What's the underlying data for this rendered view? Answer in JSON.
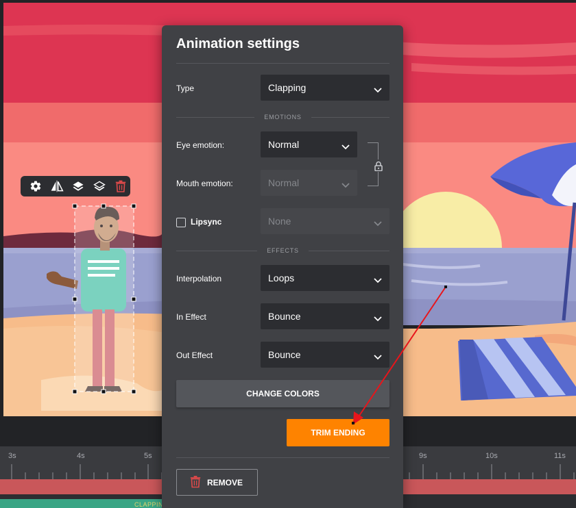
{
  "panel": {
    "title": "Animation settings",
    "type_label": "Type",
    "type_value": "Clapping",
    "emotions_heading": "EMOTIONS",
    "eye_label": "Eye emotion:",
    "eye_value": "Normal",
    "mouth_label": "Mouth emotion:",
    "mouth_value": "Normal",
    "lipsync_label": "Lipsync",
    "lipsync_checked": false,
    "lipsync_value": "None",
    "effects_heading": "EFFECTS",
    "interpolation_label": "Interpolation",
    "interpolation_value": "Loops",
    "in_effect_label": "In Effect",
    "in_effect_value": "Bounce",
    "out_effect_label": "Out Effect",
    "out_effect_value": "Bounce",
    "change_colors_label": "CHANGE COLORS",
    "trim_ending_label": "TRIM ENDING",
    "remove_label": "REMOVE"
  },
  "toolbar": {
    "icons": [
      "gear-icon",
      "flip-icon",
      "layer-up-icon",
      "layer-down-icon",
      "trash-icon"
    ]
  },
  "timeline": {
    "ticks": [
      "3s",
      "4s",
      "5s",
      "9s",
      "10s",
      "11s"
    ],
    "clip_label": "CLAPPIN"
  },
  "colors": {
    "accent": "#fe8300",
    "panel": "#404145",
    "input": "#2c2d31",
    "delete": "#e04a4a",
    "arrow": "#e8151b",
    "track": "#c9575a"
  }
}
